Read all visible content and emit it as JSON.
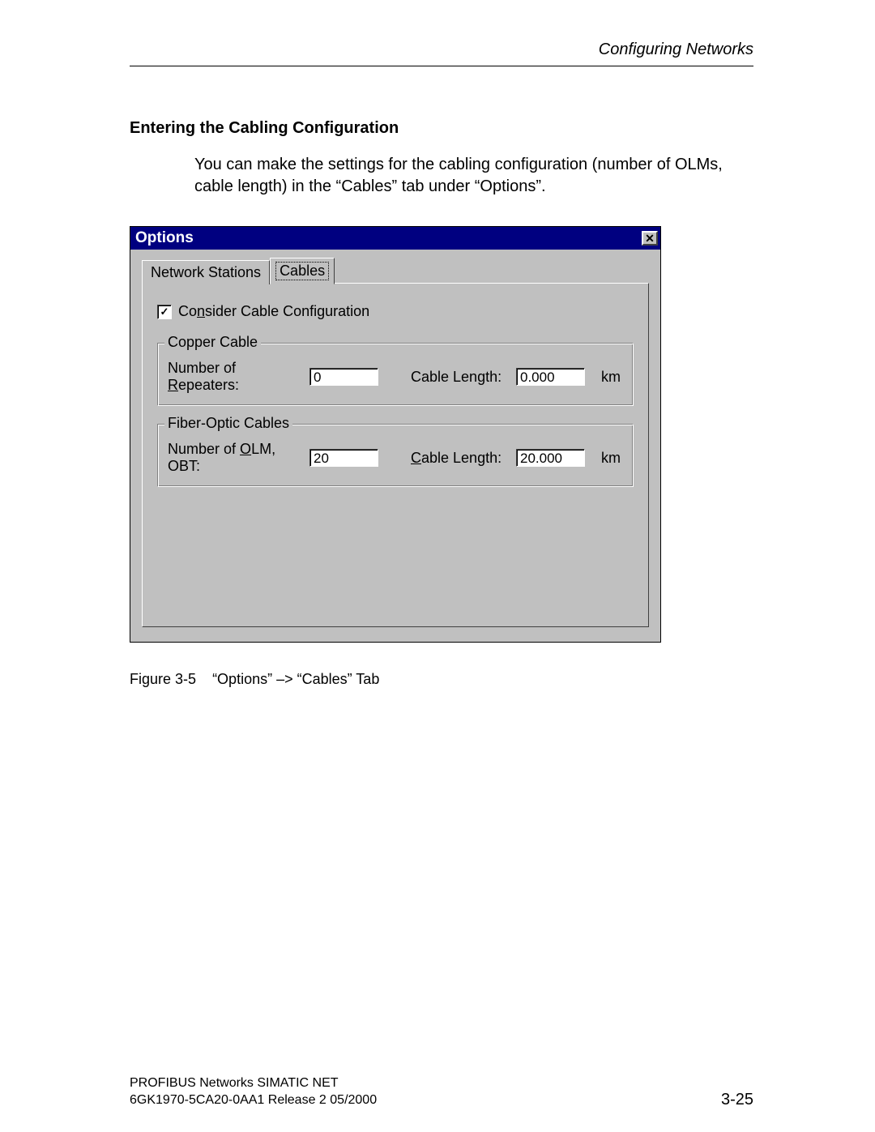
{
  "header": {
    "chapter_title": "Configuring Networks"
  },
  "section": {
    "heading": "Entering the Cabling Configuration",
    "paragraph": "You can make the settings for the cabling configuration (number of OLMs, cable length) in the “Cables”  tab under “Options”."
  },
  "dialog": {
    "title": "Options",
    "tabs": {
      "inactive": "Network Stations",
      "active": "Cables"
    },
    "checkbox": {
      "checked": true,
      "label_pre": "Co",
      "label_u": "n",
      "label_post": "sider Cable Configuration"
    },
    "group_copper": {
      "title": "Copper Cable",
      "repeaters_label_pre": "Number of ",
      "repeaters_label_u": "R",
      "repeaters_label_post": "epeaters:",
      "repeaters_value": "0",
      "length_label": "Cable Length:",
      "length_value": "0.000",
      "unit": "km"
    },
    "group_fiber": {
      "title": "Fiber-Optic Cables",
      "olm_label_pre": "Number of ",
      "olm_label_u": "O",
      "olm_label_post": "LM, OBT:",
      "olm_value": "20",
      "length_label_u": "C",
      "length_label_post": "able Length:",
      "length_value": "20.000",
      "unit": "km"
    }
  },
  "figure": {
    "number": "Figure 3-5",
    "caption": "“Options” –> “Cables” Tab"
  },
  "footer": {
    "line1": "PROFIBUS Networks SIMATIC NET",
    "line2": "6GK1970-5CA20-0AA1 Release 2 05/2000",
    "pagenum": "3-25"
  }
}
